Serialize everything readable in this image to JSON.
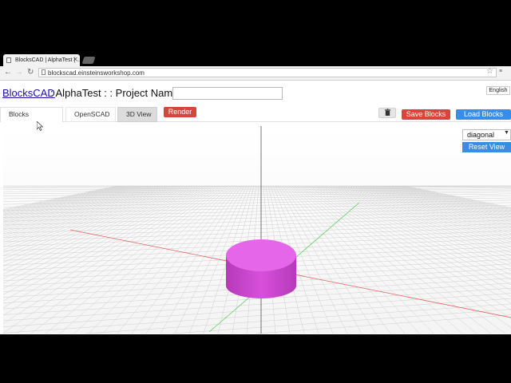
{
  "browser": {
    "tab_title": "BlocksCAD | AlphaTest | ...",
    "url": "blockscad.einsteinsworkshop.com"
  },
  "header": {
    "logo_label": "BlocksCAD",
    "title_rest": ": AlphaTest : : Project Name :",
    "project_name_value": "",
    "language": "English"
  },
  "tabs": [
    {
      "label": "Blocks"
    },
    {
      "label": "OpenSCAD"
    },
    {
      "label": "3D View"
    }
  ],
  "toolbar": {
    "render_label": "Render",
    "trash_icon": "trash-icon",
    "save_label": "Save Blocks",
    "load_label": "Load Blocks"
  },
  "view": {
    "camera_option": "diagonal",
    "reset_label": "Reset View"
  },
  "colors": {
    "brand_link": "#1a0dab",
    "red_button": "#d9443c",
    "blue_button": "#3a8de6",
    "cylinder": "#d84fdb",
    "x_axis": "#e06060",
    "y_axis": "#5fcf5f"
  }
}
